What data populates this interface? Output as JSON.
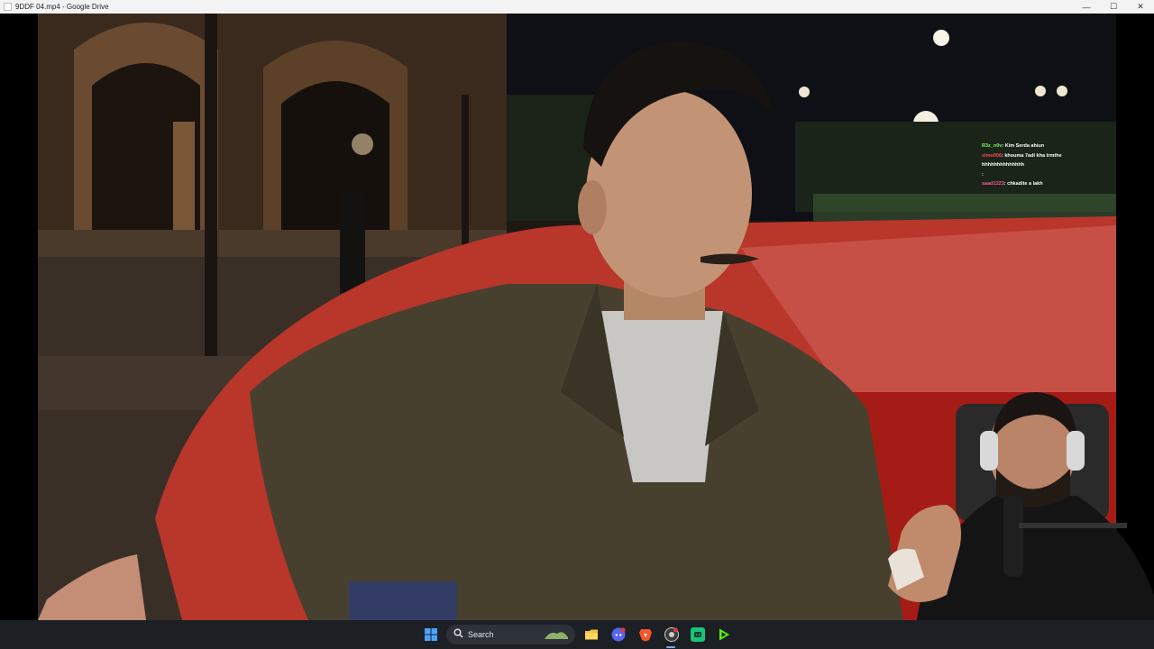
{
  "window": {
    "title": "9DDF 04.mp4 - Google Drive",
    "minimize_glyph": "—",
    "maximize_glyph": "☐",
    "close_glyph": "✕"
  },
  "chat": {
    "messages": [
      {
        "user": "R3z_n0v",
        "text": ": Kim Serda ahiun",
        "color": "#7cfc5a"
      },
      {
        "user": "simo006",
        "text": ": khouma 7adi kha trmthe",
        "color": "#ff4d4d"
      },
      {
        "user": "",
        "text": "hhhhhhhhhhhhhh",
        "color": "#ffffff"
      },
      {
        "user": "",
        "text": ": ",
        "color": "#ff5aa0"
      },
      {
        "user": "saad1223",
        "text": ": chkadite a lakh",
        "color": "#ff5aa0"
      }
    ]
  },
  "taskbar": {
    "search_label": "Search",
    "icons": [
      "windows-start-icon",
      "search-icon",
      "file-explorer-icon",
      "discord-icon",
      "brave-icon",
      "chrome-icon",
      "app-icon",
      "media-player-icon"
    ],
    "accent_color": "#7aa7ff"
  }
}
